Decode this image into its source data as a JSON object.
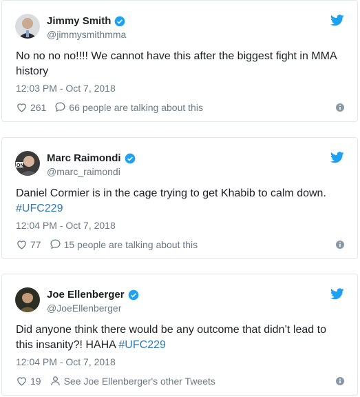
{
  "tweets": [
    {
      "name": "Jimmy Smith",
      "handle": "@jimmysmithmma",
      "text_parts": [
        "No no no no!!!! We cannot have this after the biggest fight in MMA history"
      ],
      "time": "12:03 PM - Oct 7, 2018",
      "likes": "261",
      "secondary": "66 people are talking about this"
    },
    {
      "name": "Marc Raimondi",
      "handle": "@marc_raimondi",
      "text": "Daniel Cormier is in the cage trying to get Khabib to calm down.",
      "hashtag": "#UFC229",
      "time": "12:04 PM - Oct 7, 2018",
      "likes": "77",
      "secondary": "15 people are talking about this"
    },
    {
      "name": "Joe Ellenberger",
      "handle": "@JoeEllenberger",
      "text": "Did anyone think there would be any outcome that didn’t lead to this insanity?! HAHA",
      "hashtag": "#UFC229",
      "time": "12:04 PM - Oct 7, 2018",
      "likes": "19",
      "secondary": "See Joe Ellenberger's other Tweets"
    }
  ],
  "colors": {
    "accent": "#1da1f2",
    "link": "#2b7bb9",
    "muted": "#697882",
    "border": "#e1e8ed"
  },
  "icons": [
    "verified-badge-icon",
    "twitter-bird-icon",
    "heart-icon",
    "speech-bubble-icon",
    "person-icon",
    "info-icon"
  ]
}
